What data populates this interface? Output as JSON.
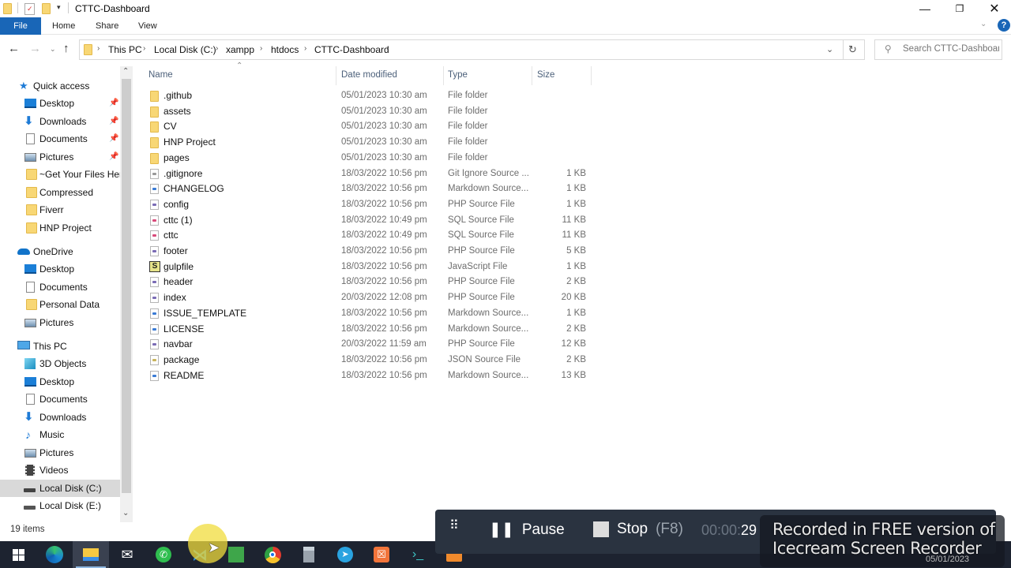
{
  "window": {
    "title": "CTTC-Dashboard",
    "controls": {
      "minimize": "minimize-icon",
      "restore": "restore-icon",
      "close": "close-icon"
    }
  },
  "ribbon": {
    "tabs": [
      {
        "label": "File",
        "active": true
      },
      {
        "label": "Home"
      },
      {
        "label": "Share"
      },
      {
        "label": "View"
      }
    ],
    "help_icon": "help-icon",
    "accent": "#1966b7"
  },
  "address": {
    "breadcrumbs": [
      "This PC",
      "Local Disk (C:)",
      "xampp",
      "htdocs",
      "CTTC-Dashboard"
    ],
    "search_placeholder": "Search CTTC-Dashboard"
  },
  "nav": {
    "quick_access": {
      "label": "Quick access",
      "items": [
        {
          "label": "Desktop",
          "icon": "desktop-icon",
          "pinned": true
        },
        {
          "label": "Downloads",
          "icon": "downloads-icon",
          "pinned": true
        },
        {
          "label": "Documents",
          "icon": "documents-icon",
          "pinned": true
        },
        {
          "label": "Pictures",
          "icon": "pictures-icon",
          "pinned": true
        },
        {
          "label": "~Get Your Files Here",
          "icon": "folder-icon"
        },
        {
          "label": "Compressed",
          "icon": "folder-icon"
        },
        {
          "label": "Fiverr",
          "icon": "folder-icon"
        },
        {
          "label": "HNP Project",
          "icon": "folder-icon"
        }
      ]
    },
    "onedrive": {
      "label": "OneDrive",
      "items": [
        {
          "label": "Desktop",
          "icon": "desktop-icon"
        },
        {
          "label": "Documents",
          "icon": "documents-icon"
        },
        {
          "label": "Personal Data",
          "icon": "folder-icon"
        },
        {
          "label": "Pictures",
          "icon": "pictures-icon"
        }
      ]
    },
    "this_pc": {
      "label": "This PC",
      "items": [
        {
          "label": "3D Objects",
          "icon": "3d-objects-icon"
        },
        {
          "label": "Desktop",
          "icon": "desktop-icon"
        },
        {
          "label": "Documents",
          "icon": "documents-icon"
        },
        {
          "label": "Downloads",
          "icon": "downloads-icon"
        },
        {
          "label": "Music",
          "icon": "music-icon"
        },
        {
          "label": "Pictures",
          "icon": "pictures-icon"
        },
        {
          "label": "Videos",
          "icon": "videos-icon"
        },
        {
          "label": "Local Disk (C:)",
          "icon": "drive-c-icon",
          "selected": true
        },
        {
          "label": "Local Disk (E:)",
          "icon": "drive-icon"
        }
      ]
    }
  },
  "files": {
    "columns": [
      "Name",
      "Date modified",
      "Type",
      "Size"
    ],
    "sort": {
      "column": "Name",
      "direction": "ascending"
    },
    "rows": [
      {
        "name": ".github",
        "date": "05/01/2023 10:30 am",
        "type": "File folder",
        "size": "",
        "icon": "folder"
      },
      {
        "name": "assets",
        "date": "05/01/2023 10:30 am",
        "type": "File folder",
        "size": "",
        "icon": "folder"
      },
      {
        "name": "CV",
        "date": "05/01/2023 10:30 am",
        "type": "File folder",
        "size": "",
        "icon": "folder"
      },
      {
        "name": "HNP Project",
        "date": "05/01/2023 10:30 am",
        "type": "File folder",
        "size": "",
        "icon": "folder"
      },
      {
        "name": "pages",
        "date": "05/01/2023 10:30 am",
        "type": "File folder",
        "size": "",
        "icon": "folder"
      },
      {
        "name": ".gitignore",
        "date": "18/03/2022 10:56 pm",
        "type": "Git Ignore Source ...",
        "size": "1 KB",
        "icon": "gitignore"
      },
      {
        "name": "CHANGELOG",
        "date": "18/03/2022 10:56 pm",
        "type": "Markdown Source...",
        "size": "1 KB",
        "icon": "markdown"
      },
      {
        "name": "config",
        "date": "18/03/2022 10:56 pm",
        "type": "PHP Source File",
        "size": "1 KB",
        "icon": "php"
      },
      {
        "name": "cttc (1)",
        "date": "18/03/2022 10:49 pm",
        "type": "SQL Source File",
        "size": "11 KB",
        "icon": "sql"
      },
      {
        "name": "cttc",
        "date": "18/03/2022 10:49 pm",
        "type": "SQL Source File",
        "size": "11 KB",
        "icon": "sql"
      },
      {
        "name": "footer",
        "date": "18/03/2022 10:56 pm",
        "type": "PHP Source File",
        "size": "5 KB",
        "icon": "php"
      },
      {
        "name": "gulpfile",
        "date": "18/03/2022 10:56 pm",
        "type": "JavaScript File",
        "size": "1 KB",
        "icon": "javascript"
      },
      {
        "name": "header",
        "date": "18/03/2022 10:56 pm",
        "type": "PHP Source File",
        "size": "2 KB",
        "icon": "php"
      },
      {
        "name": "index",
        "date": "20/03/2022 12:08 pm",
        "type": "PHP Source File",
        "size": "20 KB",
        "icon": "php"
      },
      {
        "name": "ISSUE_TEMPLATE",
        "date": "18/03/2022 10:56 pm",
        "type": "Markdown Source...",
        "size": "1 KB",
        "icon": "markdown"
      },
      {
        "name": "LICENSE",
        "date": "18/03/2022 10:56 pm",
        "type": "Markdown Source...",
        "size": "2 KB",
        "icon": "markdown"
      },
      {
        "name": "navbar",
        "date": "20/03/2022 11:59 am",
        "type": "PHP Source File",
        "size": "12 KB",
        "icon": "php"
      },
      {
        "name": "package",
        "date": "18/03/2022 10:56 pm",
        "type": "JSON Source File",
        "size": "2 KB",
        "icon": "json"
      },
      {
        "name": "README",
        "date": "18/03/2022 10:56 pm",
        "type": "Markdown Source...",
        "size": "13 KB",
        "icon": "markdown"
      }
    ]
  },
  "status": {
    "item_count": "19 items"
  },
  "taskbar": {
    "apps": [
      "start",
      "edge",
      "file-explorer",
      "mail",
      "whatsapp",
      "vscode",
      "coreldraw",
      "chrome",
      "calculator",
      "telegram",
      "xampp",
      "terminal-app",
      "icecream-recorder"
    ],
    "active": "file-explorer"
  },
  "recorder": {
    "pause_label": "Pause",
    "stop_label": "Stop",
    "stop_shortcut": "(F8)",
    "time_dim": "00:00:",
    "time_seconds": "29",
    "watermark_line1": "Recorded in FREE version of",
    "watermark_line2": "Icecream  Screen  Recorder",
    "tray_date": "05/01/2023"
  }
}
